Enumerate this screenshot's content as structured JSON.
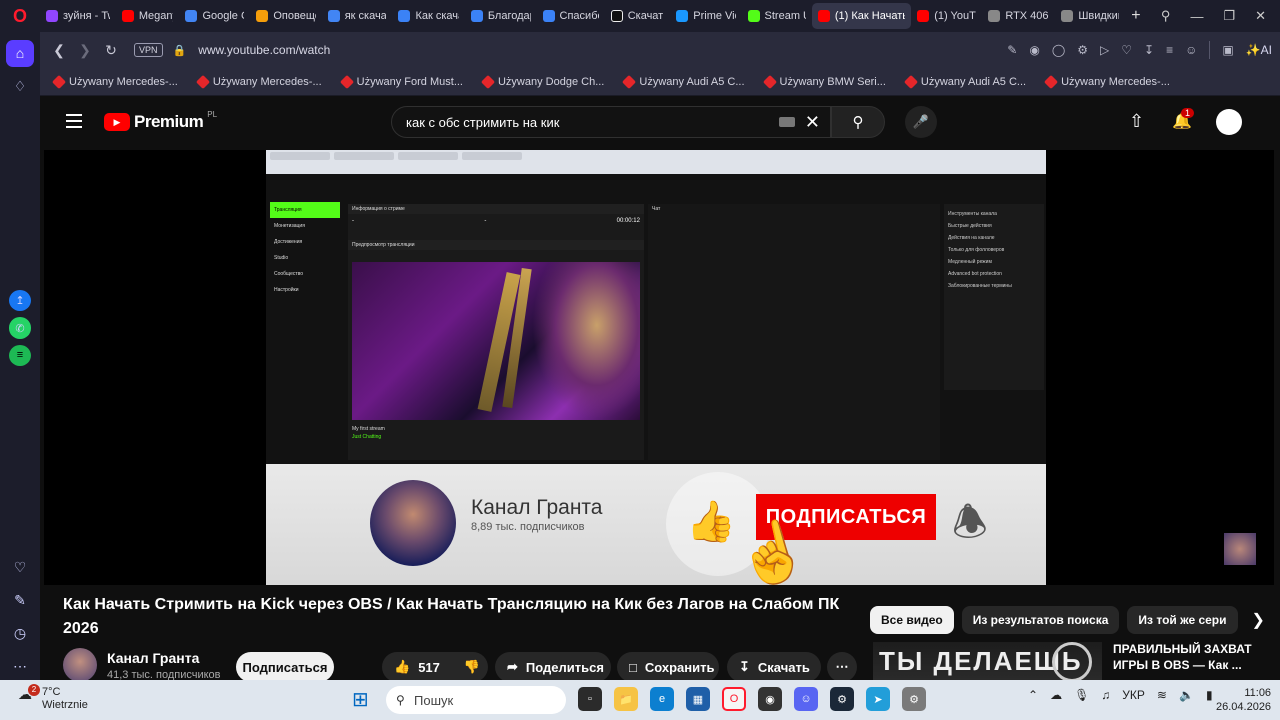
{
  "tabs": [
    {
      "label": "зуйня - Tw",
      "color": "#9146ff"
    },
    {
      "label": "Megany",
      "color": "#ff0000"
    },
    {
      "label": "Google G",
      "color": "#4285f4"
    },
    {
      "label": "Оповеще",
      "color": "#f59e0b"
    },
    {
      "label": "як скачат",
      "color": "#4285f4"
    },
    {
      "label": "Как скача",
      "color": "#3b82f6"
    },
    {
      "label": "Благодар",
      "color": "#3b82f6"
    },
    {
      "label": "Спасибо",
      "color": "#3b82f6"
    },
    {
      "label": "Скачать",
      "color": "#111111"
    },
    {
      "label": "Prime Vid",
      "color": "#1a98ff"
    },
    {
      "label": "Stream U",
      "color": "#53fc18"
    },
    {
      "label": "(1) Как Начать С",
      "color": "#ff0000"
    },
    {
      "label": "(1) YouTu",
      "color": "#ff0000"
    },
    {
      "label": "RTX 4060",
      "color": "#888888"
    },
    {
      "label": "Швидкий",
      "color": "#888888"
    }
  ],
  "browser": {
    "vpn_label": "VPN",
    "url": "www.youtube.com/watch",
    "ai_label": "AI"
  },
  "bookmarks": [
    "Używany Mercedes-...",
    "Używany Mercedes-...",
    "Używany Ford Must...",
    "Używany Dodge Ch...",
    "Używany Audi A5 C...",
    "Używany BMW Seri...",
    "Używany Audi A5 C...",
    "Używany Mercedes-..."
  ],
  "youtube": {
    "brand": "Premium",
    "region": "PL",
    "search_query": "как с обс стримить на кик",
    "notification_count": "1"
  },
  "video_frame": {
    "kick_sidebar": [
      "Трансляция",
      "Монетизация",
      "Достижения",
      "Studio",
      "Сообщество",
      "Настройки"
    ],
    "panel_header": "Информация о стриме",
    "stat_time": "00:00:12",
    "preview_header": "Предпросмотр трансляции",
    "chat_header": "Чат",
    "right_header": "Инструменты канала",
    "right_items": [
      "Быстрые действия",
      "Действия на канале",
      "Только для фолловеров",
      "Медленный режим",
      "Advanced bot protection",
      "Заблокированные термины"
    ],
    "stream_title": "My first stream",
    "category": "Just Chatting",
    "banner_channel": "Канал Гранта",
    "banner_subs": "8,89 тыс. подписчиков",
    "banner_subscribe": "ПОДПИСАТЬСЯ"
  },
  "video": {
    "title": "Как Начать Стримить на Kick через OBS / Как Начать Трансляцию на Кик без Лагов на Слабом ПК 2026",
    "channel_name": "Канал Гранта",
    "channel_subs": "41,3 тыс. подписчиков",
    "subscribe_label": "Подписаться",
    "likes": "517",
    "share_label": "Поделиться",
    "save_label": "Сохранить",
    "download_label": "Скачать"
  },
  "related": {
    "chips": [
      "Все видео",
      "Из результатов поиска",
      "Из той же сери"
    ],
    "thumb_text": "ТЫ ДЕЛАЕШЬ",
    "title": "ПРАВИЛЬНЫЙ ЗАХВАТ ИГРЫ В OBS — Как ..."
  },
  "taskbar": {
    "temperature": "7°C",
    "condition": "Wietrznie",
    "weather_badge": "2",
    "search_placeholder": "Пошук",
    "language": "УКР",
    "time": "11:06",
    "date": "26.04.2026"
  }
}
